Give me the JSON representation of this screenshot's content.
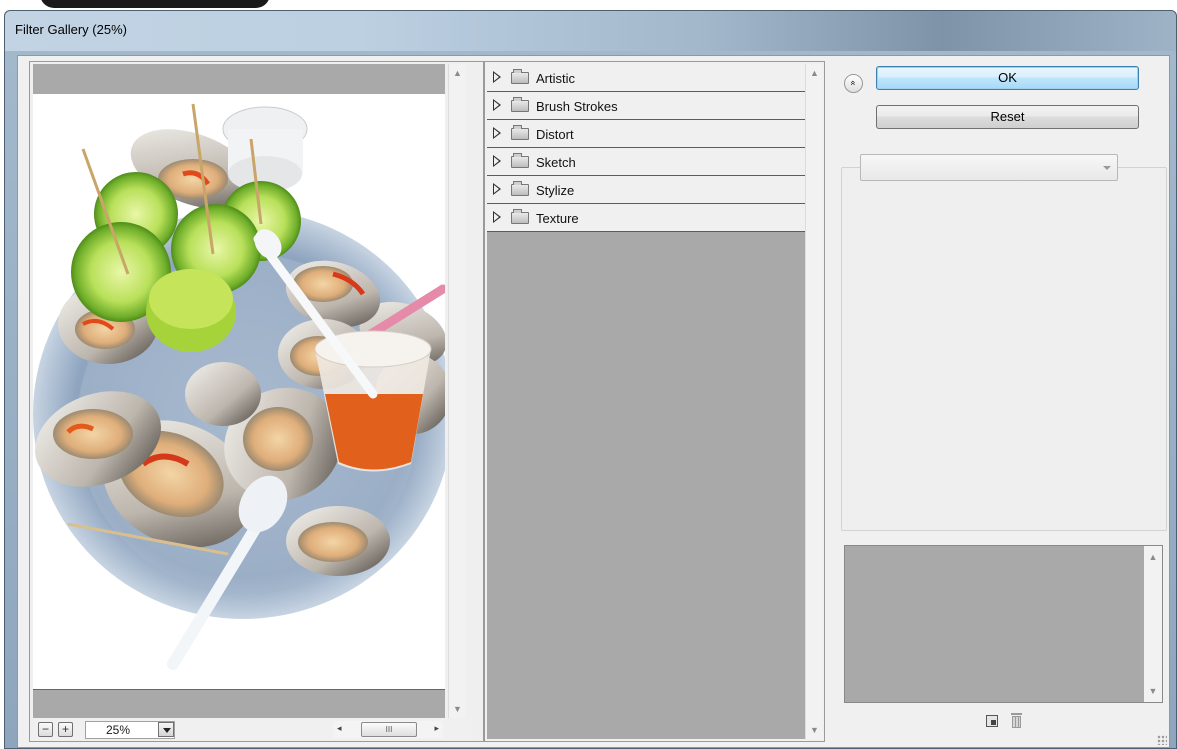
{
  "window": {
    "title": "Filter Gallery (25%)"
  },
  "preview": {
    "zoom_value": "25%",
    "zoom_out_label": "−",
    "zoom_in_label": "+",
    "hscroll_thumb": "III"
  },
  "filters": {
    "categories": [
      {
        "label": "Artistic"
      },
      {
        "label": "Brush Strokes"
      },
      {
        "label": "Distort"
      },
      {
        "label": "Sketch"
      },
      {
        "label": "Stylize"
      },
      {
        "label": "Texture"
      }
    ]
  },
  "actions": {
    "ok_label": "OK",
    "reset_label": "Reset",
    "expand_label": "«"
  },
  "settings": {
    "filter_select_value": ""
  },
  "icons": {
    "expand": "double-chevron-up-icon",
    "new_layer": "new-effect-layer-icon",
    "delete_layer": "trash-icon",
    "category_toggle": "disclosure-triangle-icon",
    "category_folder": "folder-icon"
  },
  "colors": {
    "ok_border": "#3c7fb1",
    "panel_grey": "#a9a9a9",
    "window_frame": "#8ea6bd"
  }
}
